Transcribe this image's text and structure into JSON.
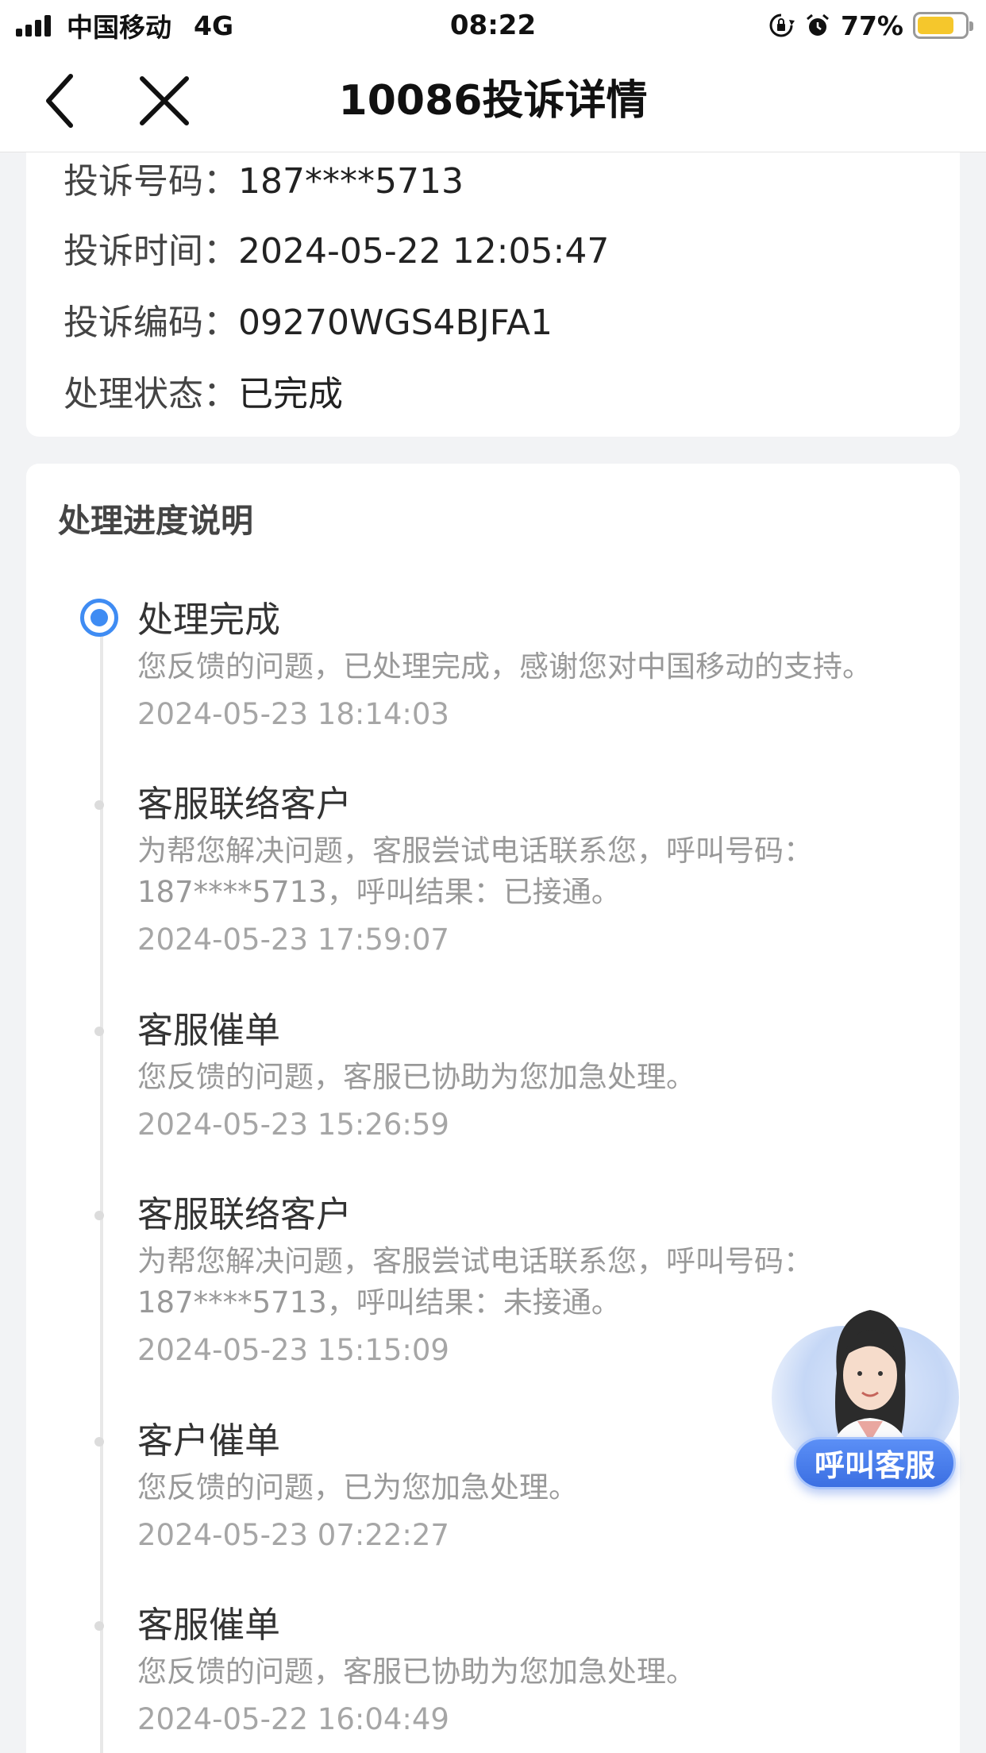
{
  "status_bar": {
    "carrier": "中国移动",
    "network": "4G",
    "time": "08:22",
    "battery_percent": "77%",
    "battery_level": 0.77,
    "icons": [
      "signal-icon",
      "rotation-lock-icon",
      "alarm-icon",
      "battery-icon"
    ]
  },
  "nav": {
    "title": "10086投诉详情",
    "back_icon": "chevron-left-icon",
    "close_icon": "close-icon"
  },
  "complaint_info": [
    {
      "label": "投诉号码：",
      "value": "187****5713"
    },
    {
      "label": "投诉时间：",
      "value": "2024-05-22 12:05:47"
    },
    {
      "label": "投诉编码：",
      "value": "09270WGS4BJFA1"
    },
    {
      "label": "处理状态：",
      "value": "已完成"
    }
  ],
  "progress": {
    "section_title": "处理进度说明",
    "items": [
      {
        "title": "处理完成",
        "desc": "您反馈的问题，已处理完成，感谢您对中国移动的支持。",
        "time": "2024-05-23 18:14:03",
        "active": true
      },
      {
        "title": "客服联络客户",
        "desc": "为帮您解决问题，客服尝试电话联系您，呼叫号码：187****5713，呼叫结果：已接通。",
        "time": "2024-05-23 17:59:07",
        "active": false
      },
      {
        "title": "客服催单",
        "desc": "您反馈的问题，客服已协助为您加急处理。",
        "time": "2024-05-23 15:26:59",
        "active": false
      },
      {
        "title": "客服联络客户",
        "desc": "为帮您解决问题，客服尝试电话联系您，呼叫号码：187****5713，呼叫结果：未接通。",
        "time": "2024-05-23 15:15:09",
        "active": false
      },
      {
        "title": "客户催单",
        "desc": "您反馈的问题，已为您加急处理。",
        "time": "2024-05-23 07:22:27",
        "active": false
      },
      {
        "title": "客服催单",
        "desc": "您反馈的问题，客服已协助为您加急处理。",
        "time": "2024-05-22 16:04:49",
        "active": false
      }
    ]
  },
  "floating_service": {
    "label": "呼叫客服"
  },
  "colors": {
    "accent": "#3f8cf3",
    "background": "#f2f3f5",
    "muted_text": "#999999"
  }
}
